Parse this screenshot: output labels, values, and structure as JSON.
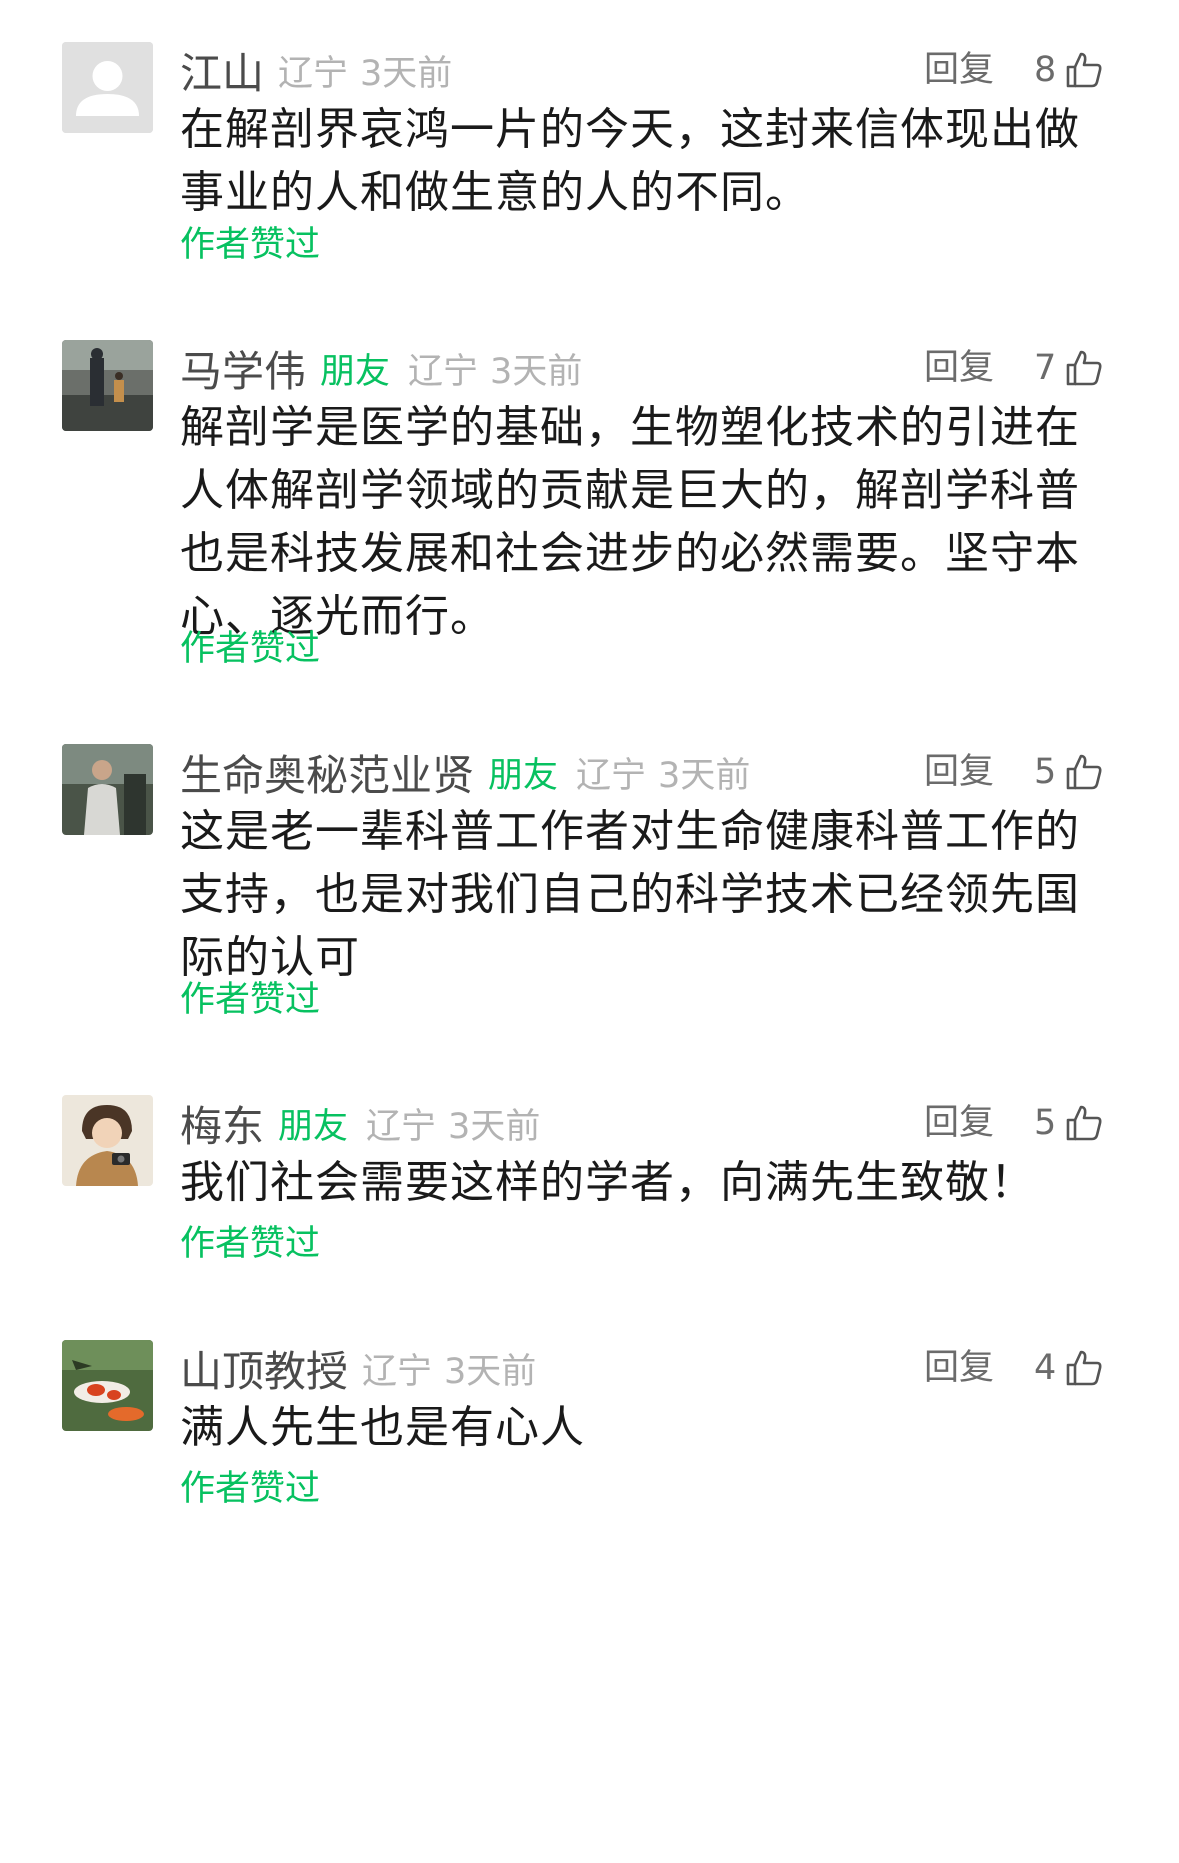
{
  "comments": [
    {
      "name": "江山",
      "friend": "",
      "location": "辽宁",
      "time": "3天前",
      "reply": "回复",
      "likes": "8",
      "content": "在解剖界哀鸿一片的今天，这封来信体现出做事业的人和做生意的人的不同。",
      "author_liked": "作者赞过",
      "avatar": "default-avatar"
    },
    {
      "name": "马学伟",
      "friend": "朋友",
      "location": "辽宁",
      "time": "3天前",
      "reply": "回复",
      "likes": "7",
      "content": "解剖学是医学的基础，生物塑化技术的引进在人体解剖学领域的贡献是巨大的，解剖学科普也是科技发展和社会进步的必然需要。坚守本心、逐光而行。",
      "author_liked": "作者赞过",
      "avatar": "photo-street"
    },
    {
      "name": "生命奥秘范业贤",
      "friend": "朋友",
      "location": "辽宁",
      "time": "3天前",
      "reply": "回复",
      "likes": "5",
      "content": "这是老一辈科普工作者对生命健康科普工作的支持，也是对我们自己的科学技术已经领先国际的认可",
      "author_liked": "作者赞过",
      "avatar": "photo-person"
    },
    {
      "name": "梅东",
      "friend": "朋友",
      "location": "辽宁",
      "time": "3天前",
      "reply": "回复",
      "likes": "5",
      "content": "我们社会需要这样的学者，向满先生致敬！",
      "author_liked": "作者赞过",
      "avatar": "illustration-camera"
    },
    {
      "name": "山顶教授",
      "friend": "",
      "location": "辽宁",
      "time": "3天前",
      "reply": "回复",
      "likes": "4",
      "content": "满人先生也是有心人",
      "author_liked": "作者赞过",
      "avatar": "photo-koi"
    }
  ],
  "colors": {
    "friend_green": "#07c160",
    "meta_gray": "#b3b3b3",
    "name_gray": "#4b4b4b"
  }
}
